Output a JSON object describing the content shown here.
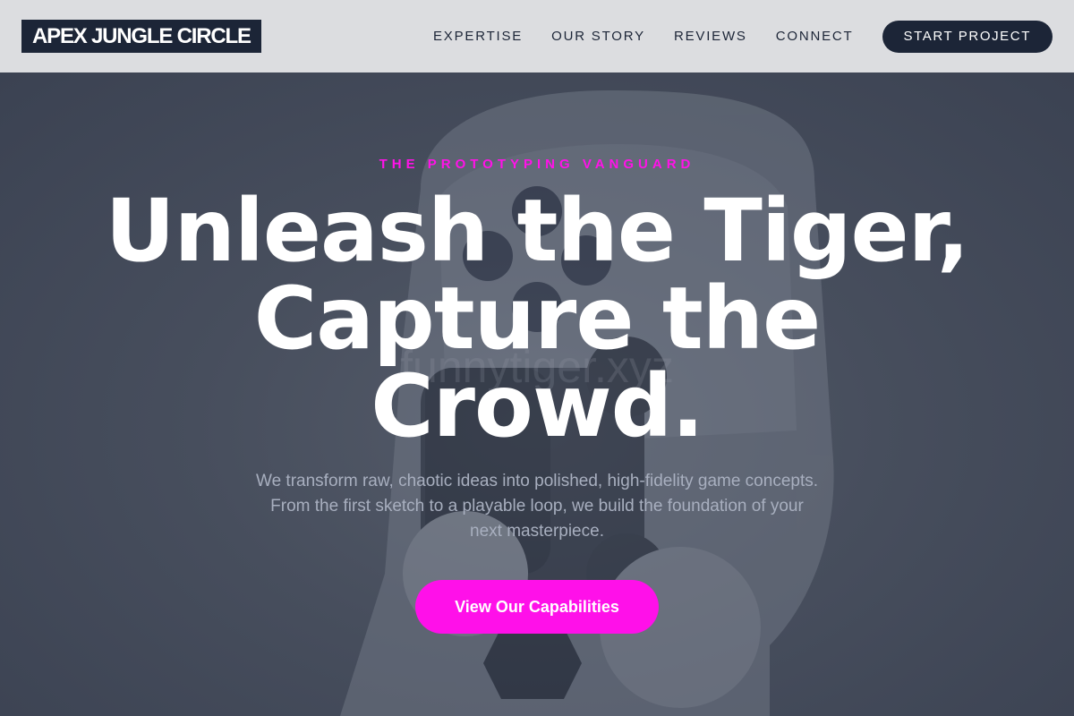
{
  "header": {
    "logo": "APEX JUNGLE CIRCLE",
    "nav": [
      {
        "label": "EXPERTISE"
      },
      {
        "label": "OUR STORY"
      },
      {
        "label": "REVIEWS"
      },
      {
        "label": "CONNECT"
      }
    ],
    "cta_label": "START PROJECT"
  },
  "hero": {
    "eyebrow": "THE PROTOTYPING VANGUARD",
    "headline": "Unleash the Tiger, Capture the Crowd.",
    "subtext": "We transform raw, chaotic ideas into polished, high-fidelity game concepts. From the first sketch to a playable loop, we build the foundation of your next masterpiece.",
    "cta_label": "View Our Capabilities",
    "watermark": "funnytiger.xyz",
    "background_image": "game-controller-photo"
  },
  "colors": {
    "navy": "#1c2537",
    "magenta": "#ff10e9",
    "header_bg": "#dcdde0",
    "hero_overlay": "#3f4656"
  }
}
